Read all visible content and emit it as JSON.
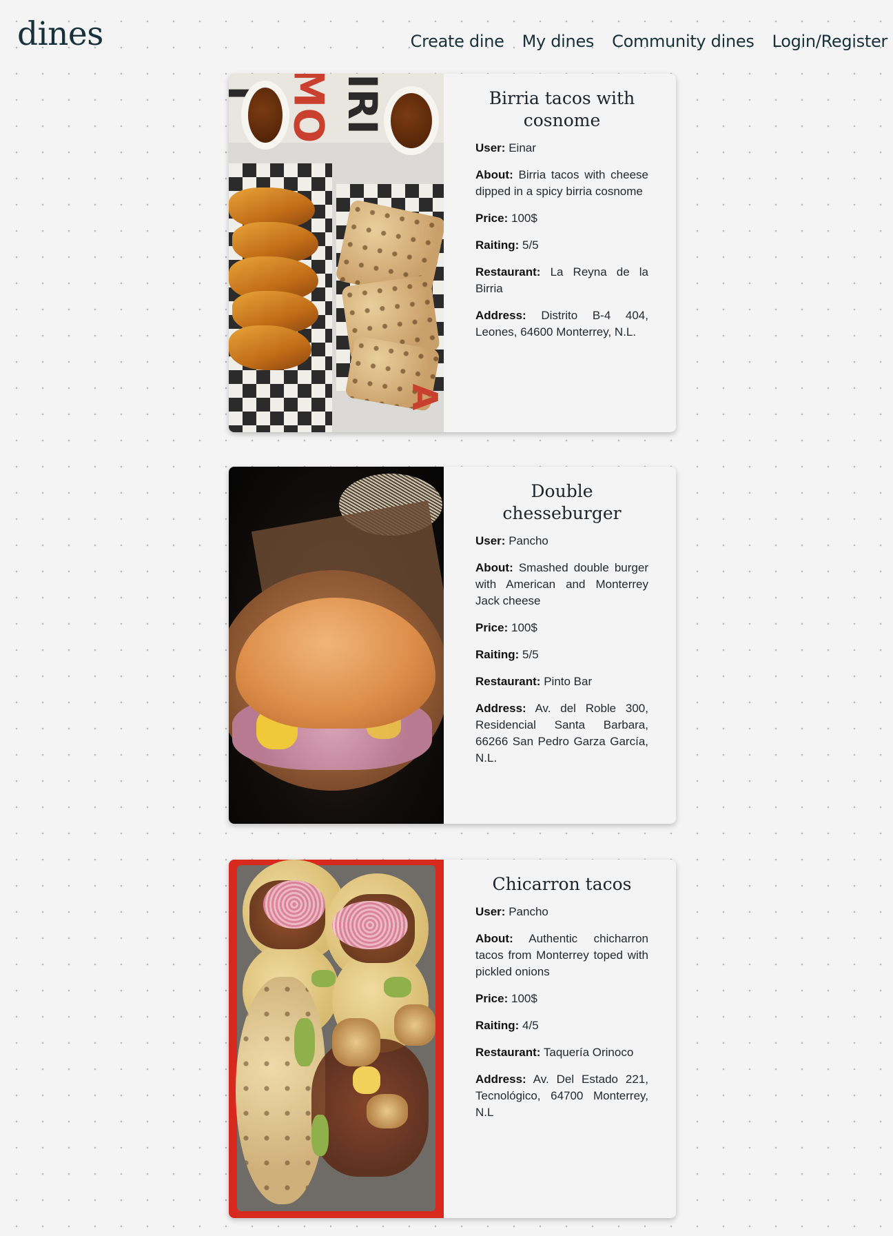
{
  "header": {
    "logo": "dines",
    "nav": [
      "Create dine",
      "My dines",
      "Community dines",
      "Login/Register"
    ]
  },
  "labels": {
    "user": "User:",
    "about": "About:",
    "price": "Price:",
    "rating": "Raiting:",
    "restaurant": "Restaurant:",
    "address": "Address:"
  },
  "dines": [
    {
      "title": "Birria tacos with cosnome",
      "user": "Einar",
      "about": "Birria tacos with cheese dipped in a spicy birria cosnome",
      "price": "100$",
      "rating": "5/5",
      "restaurant": "La Reyna de la Birria",
      "address": "Distrito B-4 404, Leones, 64600 Monterrey, N.L.",
      "image": "birria-tacos-photo"
    },
    {
      "title": "Double chesseburger",
      "user": "Pancho",
      "about": "Smashed double burger with American and Monterrey Jack cheese",
      "price": "100$",
      "rating": "5/5",
      "restaurant": "Pinto Bar",
      "address": "Av. del Roble 300, Residencial Santa Barbara, 66266 San Pedro Garza García, N.L.",
      "image": "cheeseburger-photo"
    },
    {
      "title": "Chicarron tacos",
      "user": "Pancho",
      "about": "Authentic chicharron tacos from Monterrey toped with pickled onions",
      "price": "100$",
      "rating": "4/5",
      "restaurant": "Taquería Orinoco",
      "address": "Av. Del Estado 221, Tecnológico, 64700 Monterrey, N.L",
      "image": "chicharron-tacos-photo"
    }
  ],
  "colors": {
    "background": "#f4f4f4",
    "text": "#1c2329",
    "nav": "#17303a"
  }
}
